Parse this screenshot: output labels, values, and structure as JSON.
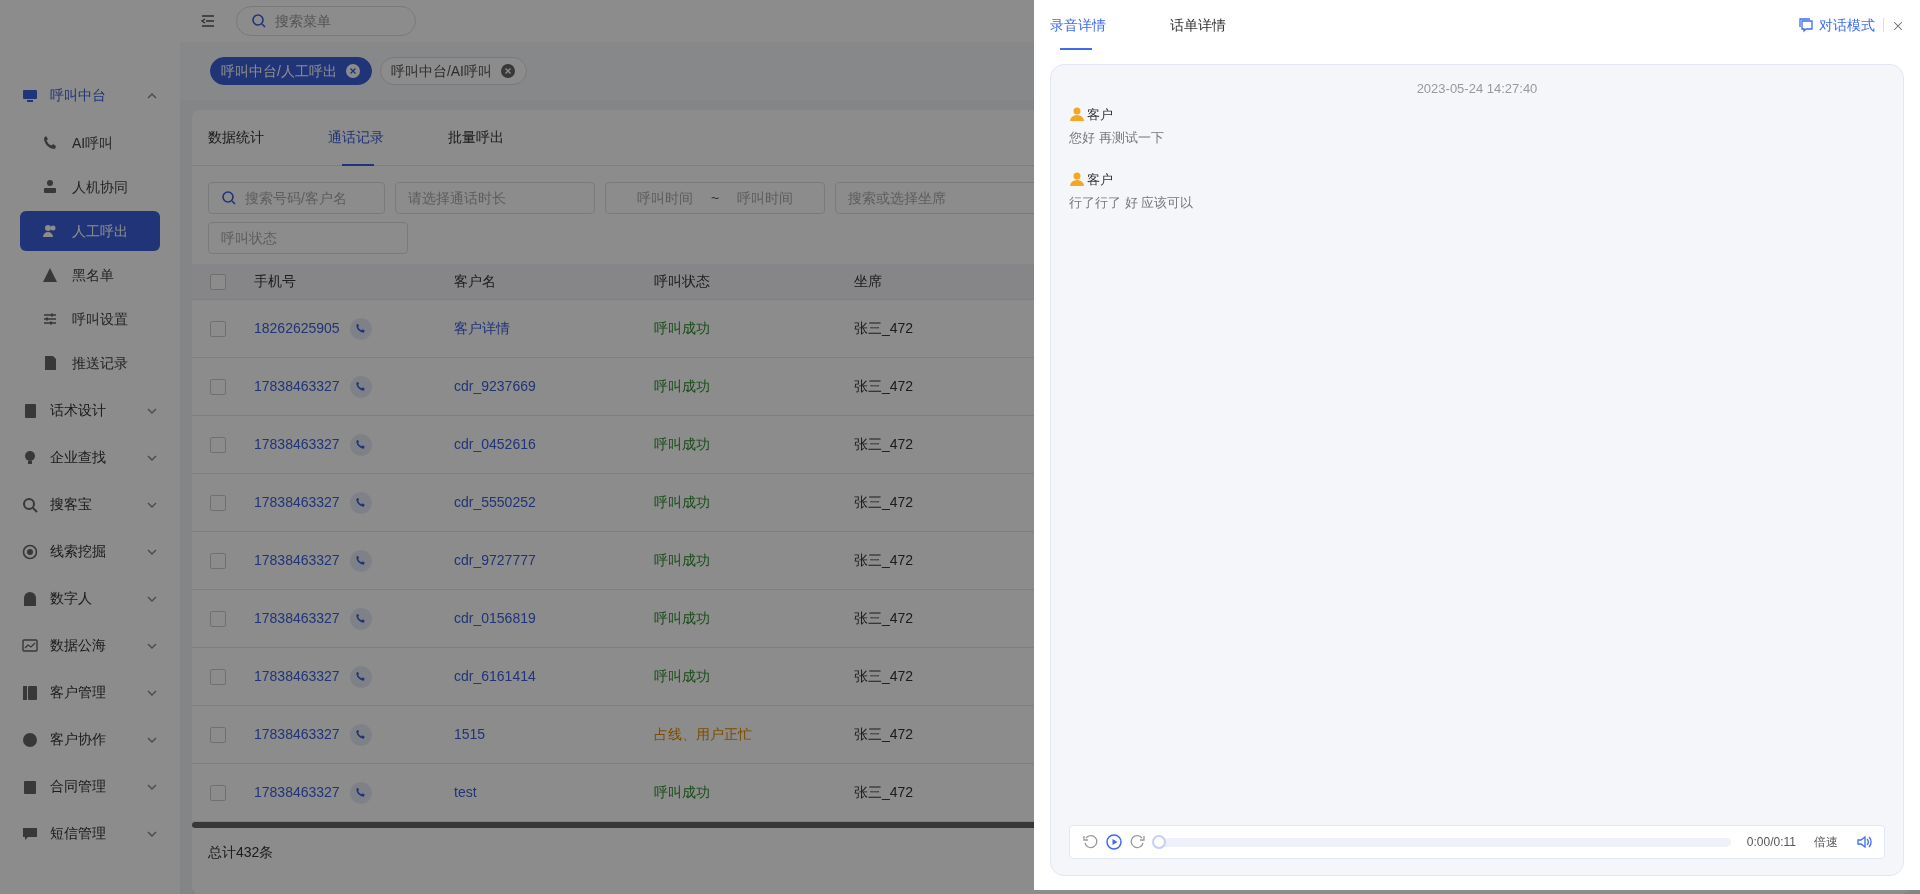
{
  "topbar": {
    "search": {
      "placeholder": "搜索菜单"
    }
  },
  "sidebar": {
    "items": [
      {
        "label": "呼叫中台",
        "expanded": true,
        "children": [
          {
            "label": "AI呼叫",
            "selected": false
          },
          {
            "label": "人机协同",
            "selected": false
          },
          {
            "label": "人工呼出",
            "selected": true
          },
          {
            "label": "黑名单",
            "selected": false
          },
          {
            "label": "呼叫设置",
            "selected": false
          },
          {
            "label": "推送记录",
            "selected": false
          }
        ]
      },
      {
        "label": "话术设计",
        "expanded": false
      },
      {
        "label": "企业查找",
        "expanded": false
      },
      {
        "label": "搜客宝",
        "expanded": false
      },
      {
        "label": "线索挖掘",
        "expanded": false
      },
      {
        "label": "数字人",
        "expanded": false
      },
      {
        "label": "数据公海",
        "expanded": false
      },
      {
        "label": "客户管理",
        "expanded": false
      },
      {
        "label": "客户协作",
        "expanded": false
      },
      {
        "label": "合同管理",
        "expanded": false
      },
      {
        "label": "短信管理",
        "expanded": false
      }
    ]
  },
  "tags": [
    {
      "label": "呼叫中台/人工呼出",
      "selected": true
    },
    {
      "label": "呼叫中台/AI呼叫",
      "selected": false
    }
  ],
  "tabs": [
    {
      "label": "数据统计",
      "selected": false
    },
    {
      "label": "通话记录",
      "selected": true
    },
    {
      "label": "批量呼出",
      "selected": false
    }
  ],
  "filters": [
    {
      "kind": "search",
      "placeholder": "搜索号码/客户名"
    },
    {
      "kind": "select",
      "placeholder": "请选择通话时长"
    },
    {
      "kind": "range",
      "start_placeholder": "呼叫时间",
      "separator": "~",
      "end_placeholder": "呼叫时间"
    },
    {
      "kind": "select",
      "placeholder": "搜索或选择坐席"
    },
    {
      "kind": "select",
      "placeholder": "呼叫状态"
    }
  ],
  "table": {
    "select_all": {
      "checked": false
    },
    "columns": [
      "手机号",
      "客户名",
      "呼叫状态",
      "坐席"
    ],
    "rows": [
      {
        "checked": false,
        "phone": "18262625905",
        "customer": "客户详情",
        "status": "呼叫成功",
        "success": true,
        "agent": "张三_472"
      },
      {
        "checked": false,
        "phone": "17838463327",
        "customer": "cdr_9237669",
        "status": "呼叫成功",
        "success": true,
        "agent": "张三_472"
      },
      {
        "checked": false,
        "phone": "17838463327",
        "customer": "cdr_0452616",
        "status": "呼叫成功",
        "success": true,
        "agent": "张三_472"
      },
      {
        "checked": false,
        "phone": "17838463327",
        "customer": "cdr_5550252",
        "status": "呼叫成功",
        "success": true,
        "agent": "张三_472"
      },
      {
        "checked": false,
        "phone": "17838463327",
        "customer": "cdr_9727777",
        "status": "呼叫成功",
        "success": true,
        "agent": "张三_472"
      },
      {
        "checked": false,
        "phone": "17838463327",
        "customer": "cdr_0156819",
        "status": "呼叫成功",
        "success": true,
        "agent": "张三_472"
      },
      {
        "checked": false,
        "phone": "17838463327",
        "customer": "cdr_6161414",
        "status": "呼叫成功",
        "success": true,
        "agent": "张三_472"
      },
      {
        "checked": false,
        "phone": "17838463327",
        "customer": "1515",
        "status": "占线、用户正忙",
        "success": false,
        "agent": "张三_472"
      },
      {
        "checked": false,
        "phone": "17838463327",
        "customer": "test",
        "status": "呼叫成功",
        "success": true,
        "agent": "张三_472"
      }
    ],
    "total": "总计432条"
  },
  "drawer": {
    "tabs": [
      {
        "label": "录音详情",
        "selected": true
      },
      {
        "label": "话单详情",
        "selected": false
      }
    ],
    "mode_button": "对话模式",
    "timestamp": "2023-05-24 14:27:40",
    "messages": [
      {
        "speaker": "客户",
        "text": "您好 再测试一下"
      },
      {
        "speaker": "客户",
        "text": "行了行了 好 应该可以"
      }
    ],
    "player": {
      "time": "0:00/0:11",
      "speed": "倍速",
      "level": 0
    }
  }
}
